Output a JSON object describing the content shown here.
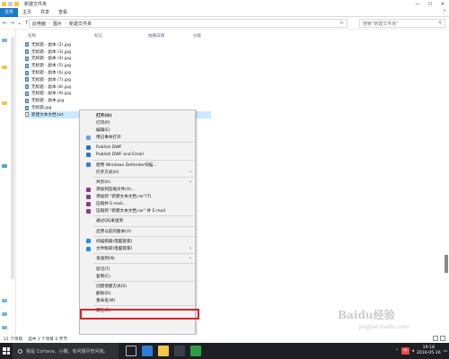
{
  "window": {
    "title": "新建文件夹",
    "controls": [
      "—",
      "☐",
      "✕"
    ]
  },
  "ribbon": {
    "tabs": [
      "文件",
      "主页",
      "共享",
      "查看"
    ],
    "help": "?"
  },
  "address": {
    "path": [
      "此电脑",
      "图片",
      "新建文件夹"
    ],
    "search_placeholder": "搜索\"新建文件夹\""
  },
  "columns": {
    "name": "名称",
    "tags": "标记",
    "date": "拍摄日期",
    "size": "分级"
  },
  "files": [
    {
      "name": "无标题 - 副本 (2).jpg",
      "type": "jpg"
    },
    {
      "name": "无标题 - 副本 (3).jpg",
      "type": "jpg"
    },
    {
      "name": "无标题 - 副本 (4).jpg",
      "type": "jpg"
    },
    {
      "name": "无标题 - 副本 (5).jpg",
      "type": "jpg"
    },
    {
      "name": "无标题 - 副本 (6).jpg",
      "type": "jpg"
    },
    {
      "name": "无标题 - 副本 (7).jpg",
      "type": "jpg"
    },
    {
      "name": "无标题 - 副本 (8).jpg",
      "type": "jpg"
    },
    {
      "name": "无标题 - 副本 (9).jpg",
      "type": "jpg"
    },
    {
      "name": "无标题 - 副本.jpg",
      "type": "jpg"
    },
    {
      "name": "无标题.jpg",
      "type": "jpg"
    },
    {
      "name": "新建文本文档.txt",
      "type": "txt",
      "selected": true
    }
  ],
  "context_menu": {
    "items": [
      {
        "label": "打开(O)",
        "bold": true
      },
      {
        "label": "打印(P)"
      },
      {
        "label": "编辑(E)"
      },
      {
        "label": "用记事本打开",
        "icon": "note-icon"
      },
      {
        "divider": true
      },
      {
        "label": "Publish DWF",
        "icon": "dwf-icon"
      },
      {
        "label": "Publish DWF and Email",
        "icon": "dwf-icon"
      },
      {
        "divider": true
      },
      {
        "label": "使用 Windows Defender扫描...",
        "icon": "defender-icon"
      },
      {
        "label": "打开方式(H)",
        "submenu": true
      },
      {
        "divider": true
      },
      {
        "label": "共享(H)",
        "submenu": true
      },
      {
        "label": "添加到压缩文件(A)...",
        "icon": "rar-icon"
      },
      {
        "label": "添加到 \"新建文本文档.rar\"(T)",
        "icon": "rar-icon"
      },
      {
        "label": "压缩并 E-mail...",
        "icon": "rar-icon"
      },
      {
        "label": "压缩到 \"新建文本文档.rar\" 并 E-mail",
        "icon": "rar-icon"
      },
      {
        "divider": true
      },
      {
        "label": "通过QQ发送到"
      },
      {
        "divider": true
      },
      {
        "label": "还原以前的版本(V)"
      },
      {
        "divider": true
      },
      {
        "label": "扫描病毒(电脑管家)",
        "icon": "qq-shield-icon"
      },
      {
        "label": "文件粉碎(电脑管家)",
        "icon": "qq-shield-icon",
        "submenu": true
      },
      {
        "divider": true
      },
      {
        "label": "发送到(N)",
        "submenu": true
      },
      {
        "divider": true
      },
      {
        "label": "剪切(T)"
      },
      {
        "label": "复制(C)"
      },
      {
        "divider": true
      },
      {
        "label": "创建快捷方式(S)"
      },
      {
        "label": "删除(D)"
      },
      {
        "label": "重命名(M)",
        "highlighted": true
      },
      {
        "divider": true
      },
      {
        "label": "属性(R)"
      }
    ]
  },
  "status": {
    "count": "11 个项目",
    "selected": "选中 1 个项目  0 字节"
  },
  "taskbar": {
    "cortana": "我是 Cortana，小娜。有问题尽管问我。",
    "time": "19:18",
    "date": "2016-05-16",
    "lang": "中"
  },
  "watermark": {
    "logo": "Baidu经验",
    "url": "jingyan.baidu.com"
  },
  "colors": {
    "accent": "#1979ca",
    "selection": "#cce8ff",
    "highlight_box": "#d9232a",
    "taskbar": "#1d1f24"
  }
}
